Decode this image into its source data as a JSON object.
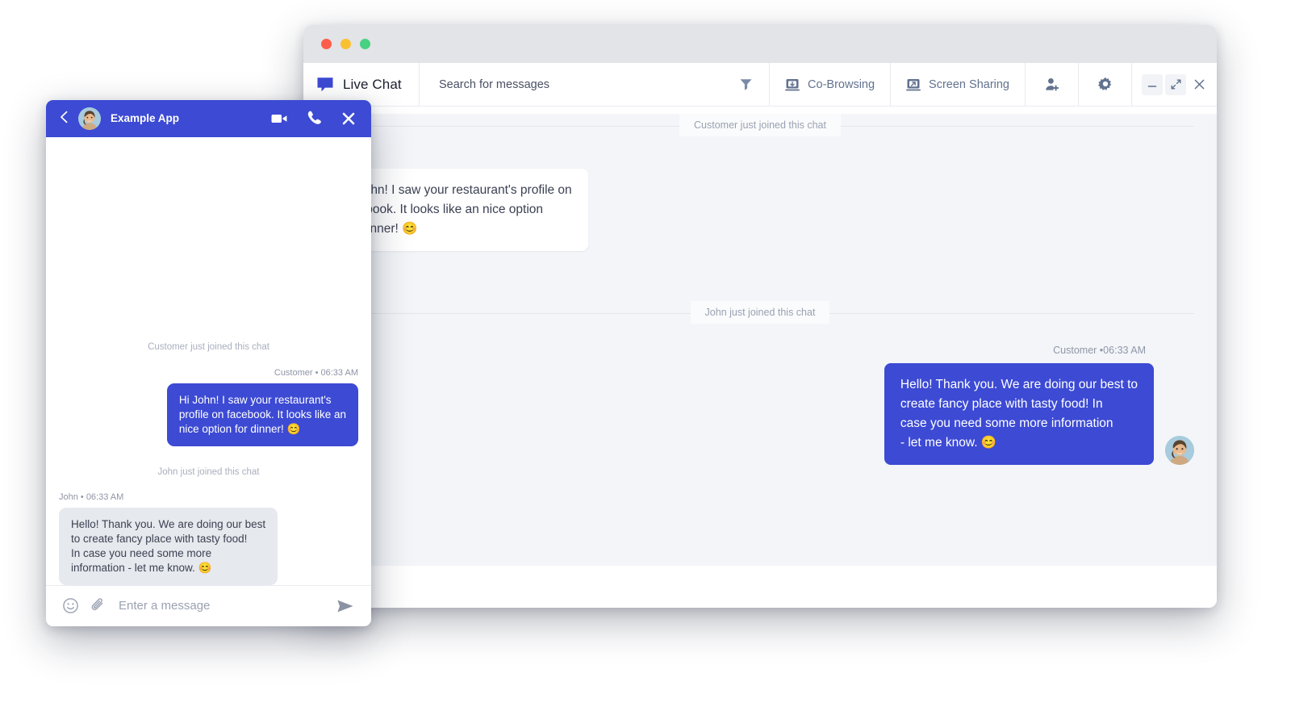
{
  "desktop": {
    "titlebar": {
      "traffic_lights": [
        {
          "name": "close",
          "color": "#fc5d4a"
        },
        {
          "name": "minimize",
          "color": "#f9c132"
        },
        {
          "name": "zoom",
          "color": "#49d182"
        }
      ]
    },
    "toolbar": {
      "brand_label": "Live Chat",
      "brand_icon": "speech-bubble-icon",
      "search_placeholder": "Search for messages",
      "search_value": "",
      "filter_icon": "filter-funnel-icon",
      "cobrowsing_label": "Co-Browsing",
      "cobrowsing_icon": "co-browsing-icon",
      "screensharing_label": "Screen Sharing",
      "screensharing_icon": "screen-sharing-icon",
      "add_user_icon": "add-user-icon",
      "settings_icon": "gear-icon",
      "minimize_icon": "minimize-icon",
      "expand_icon": "expand-arrows-icon",
      "close_icon": "close-x-icon"
    },
    "chat": {
      "events": [
        {
          "text": "Customer just joined this chat"
        },
        {
          "text": "John just joined this chat"
        }
      ],
      "messages": [
        {
          "side": "left",
          "author": "",
          "time": "",
          "text": "Hi John! I saw your restaurant's profile on\nfacebook. It looks like an nice option\nfor dinner! 😊"
        },
        {
          "side": "right",
          "author": "Customer",
          "time": "06:33 AM",
          "meta": "Customer •06:33 AM",
          "text": "Hello! Thank you. We are doing our best to\ncreate fancy place with tasty food! In\ncase you need some more information\n- let me know. 😊",
          "avatar": "agent-avatar"
        }
      ]
    }
  },
  "mobile": {
    "header": {
      "back_icon": "back-chevron-icon",
      "avatar": "agent-avatar",
      "title": "Example App",
      "video_icon": "video-camera-icon",
      "call_icon": "phone-icon",
      "close_icon": "close-x-icon"
    },
    "chat": {
      "events": [
        {
          "text": "Customer just joined this chat"
        },
        {
          "text": "John just joined this chat"
        }
      ],
      "messages": [
        {
          "side": "right",
          "meta": "Customer • 06:33 AM",
          "text": "Hi John! I saw your restaurant's\nprofile on facebook. It looks like an\nnice option for dinner! 😊"
        },
        {
          "side": "left",
          "meta": "John • 06:33 AM",
          "text": "Hello! Thank you. We are doing our best\nto create fancy place with tasty food!\nIn case you need some more\ninformation - let me know. 😊"
        }
      ]
    },
    "input": {
      "emoji_icon": "emoji-smiley-icon",
      "attach_icon": "paperclip-icon",
      "placeholder": "Enter a message",
      "value": "",
      "send_icon": "send-paper-plane-icon"
    }
  },
  "colors": {
    "brand_blue": "#3c4ad4",
    "chat_bg": "#f3f5f8",
    "toolbar_text": "#62728f",
    "titlebar_bg": "#e2e4e8"
  }
}
